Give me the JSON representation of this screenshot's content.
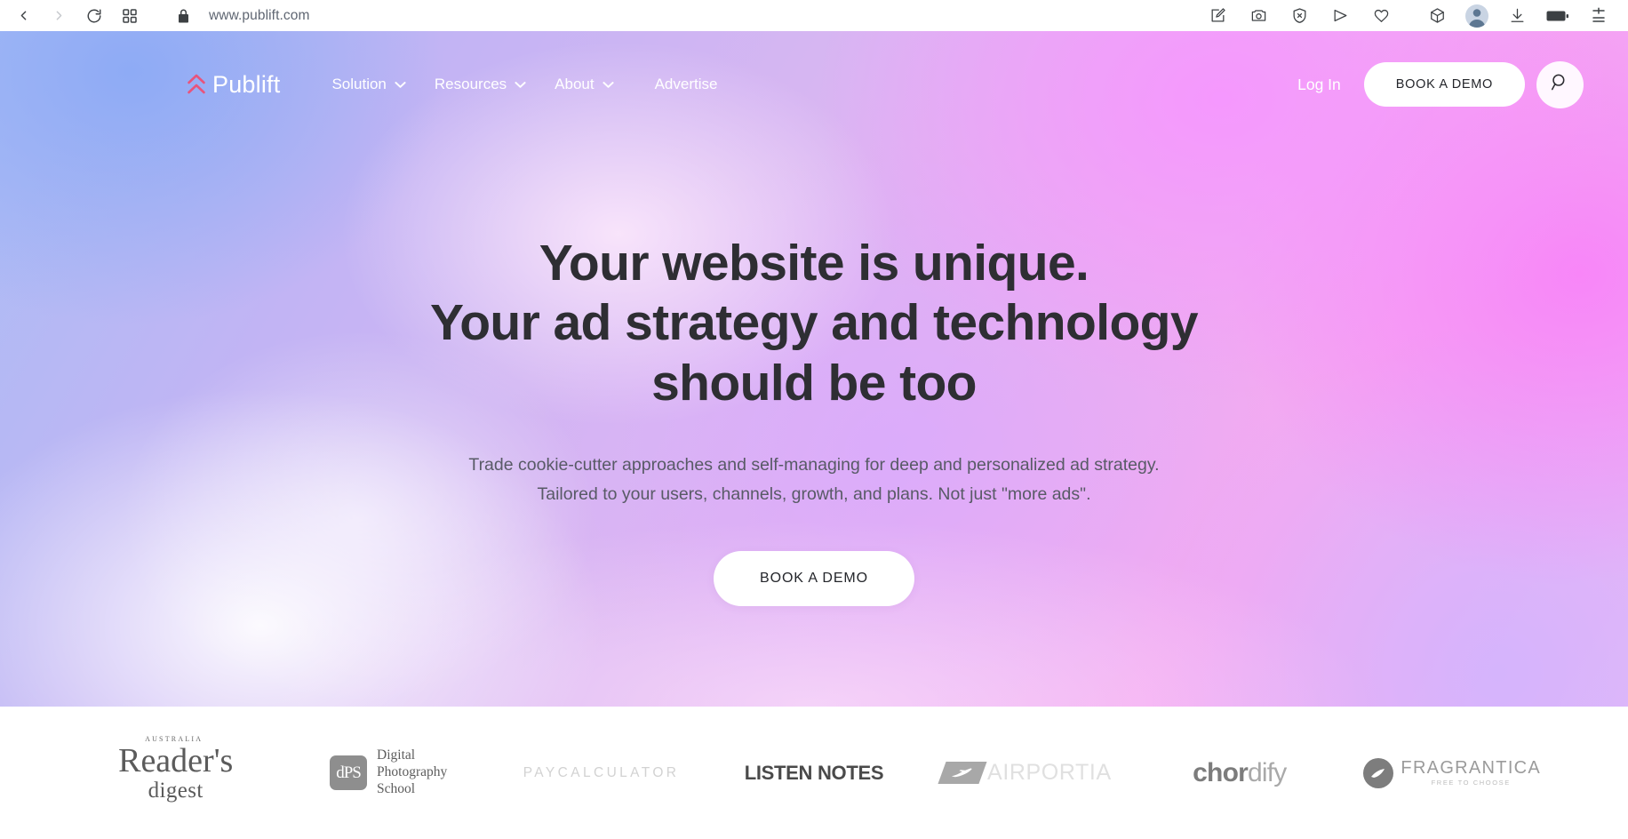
{
  "browser": {
    "url": "www.publift.com",
    "nav_icons": [
      {
        "name": "back-icon",
        "enabled": true
      },
      {
        "name": "forward-icon",
        "enabled": false
      },
      {
        "name": "reload-icon",
        "enabled": true
      },
      {
        "name": "grid-apps-icon",
        "enabled": true
      }
    ],
    "lock_icon": "padlock-icon",
    "toolbar_icons": [
      "edit-page-icon",
      "camera-screenshot-icon",
      "shield-block-icon",
      "send-share-icon",
      "heart-favorite-icon",
      "cube-extensions-icon",
      "profile-avatar-icon",
      "download-icon",
      "battery-icon",
      "menu-more-icon"
    ]
  },
  "site": {
    "brand": {
      "name": "Publift",
      "mark": "double-chevron-up-icon",
      "mark_color": "#e8547c"
    },
    "nav": [
      {
        "label": "Solution",
        "has_dropdown": true
      },
      {
        "label": "Resources",
        "has_dropdown": true
      },
      {
        "label": "About",
        "has_dropdown": true
      },
      {
        "label": "Advertise",
        "has_dropdown": false
      }
    ],
    "login_label": "Log In",
    "demo_button_label": "BOOK A DEMO",
    "search_icon": "search-icon"
  },
  "hero": {
    "title_line1": "Your website is unique.",
    "title_line2": "Your ad strategy and technology",
    "title_line3": "should be too",
    "sub_line1": "Trade cookie-cutter approaches and self-managing for deep and personalized ad strategy.",
    "sub_line2": "Tailored to your users, channels, growth, and plans. Not just \"more ads\".",
    "cta_label": "BOOK A DEMO"
  },
  "logos": {
    "readers_digest": {
      "superscript": "AUSTRALIA",
      "line1": "Reader's",
      "line2": "digest"
    },
    "dps": {
      "mark": "dPS",
      "line1": "Digital",
      "line2": "Photography",
      "line3": "School"
    },
    "paycalculator": "PAYCALCULATOR",
    "listen_notes": "LISTEN NOTES",
    "airportia": "AIRPORTIA",
    "chordify": {
      "bold": "chor",
      "light": "dify"
    },
    "fragrantica": {
      "name": "FRAGRANTICA",
      "tagline": "FREE TO CHOOSE"
    }
  },
  "colors": {
    "brand_pink": "#e8547c",
    "hero_text": "#2e2e33",
    "hero_sub_text": "#585a66",
    "button_bg": "#ffffff"
  }
}
